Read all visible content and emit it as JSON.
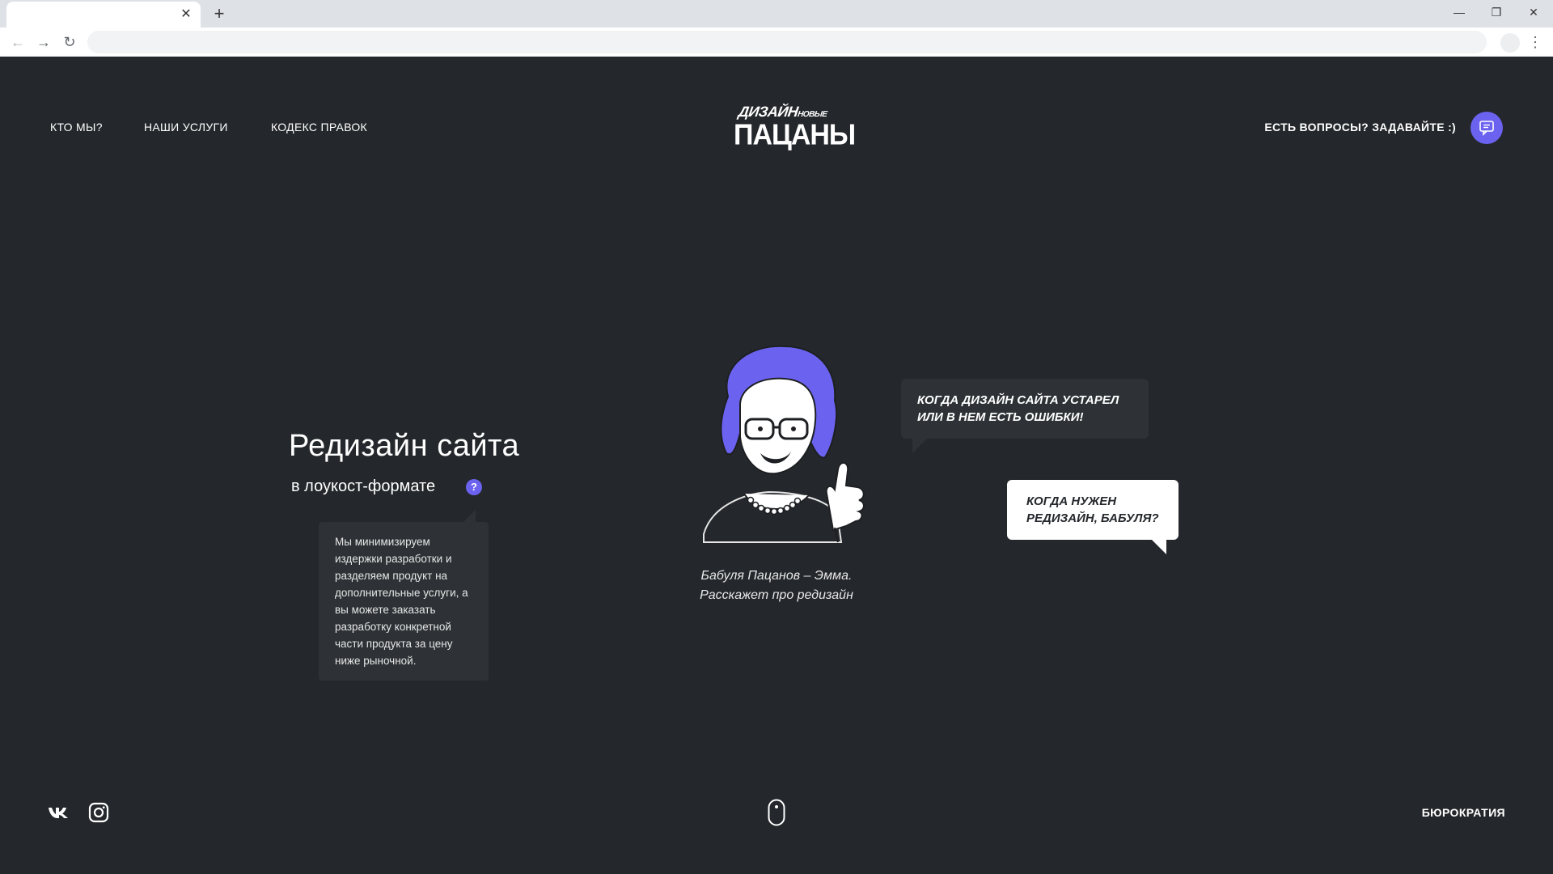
{
  "nav": {
    "items": [
      {
        "label": "КТО МЫ?"
      },
      {
        "label": "НАШИ УСЛУГИ"
      },
      {
        "label": "КОДЕКС ПРАВОК"
      }
    ]
  },
  "logo": {
    "top_main": "ДИЗАЙН",
    "top_small": "НОВЫЕ",
    "bottom": "ПАЦАНЫ"
  },
  "header": {
    "contact_text": "ЕСТЬ ВОПРОСЫ? ЗАДАВАЙТЕ :)"
  },
  "hero": {
    "title": "Редизайн сайта",
    "subtitle": "в лоукост-формате",
    "help_mark": "?",
    "tooltip": "Мы минимизируем издержки разработки и разделяем продукт на дополнительные услуги, а вы можете заказать разработку конкретной части продукта за цену ниже рыночной."
  },
  "illustration": {
    "caption_line1": "Бабуля Пацанов – Эмма.",
    "caption_line2": "Расскажет про редизайн",
    "accent_color": "#6b63f0"
  },
  "bubbles": {
    "dark": "КОГДА ДИЗАЙН САЙТА УСТАРЕЛ ИЛИ В НЕМ ЕСТЬ ОШИБКИ!",
    "light": "КОГДА НУЖЕН РЕДИЗАЙН, БАБУЛЯ?"
  },
  "footer": {
    "social": [
      "vk-icon",
      "instagram-icon"
    ],
    "bureau_link": "БЮРОКРАТИЯ"
  },
  "colors": {
    "background": "#24272b",
    "accent": "#6b63f0",
    "panel": "#2e3236"
  }
}
